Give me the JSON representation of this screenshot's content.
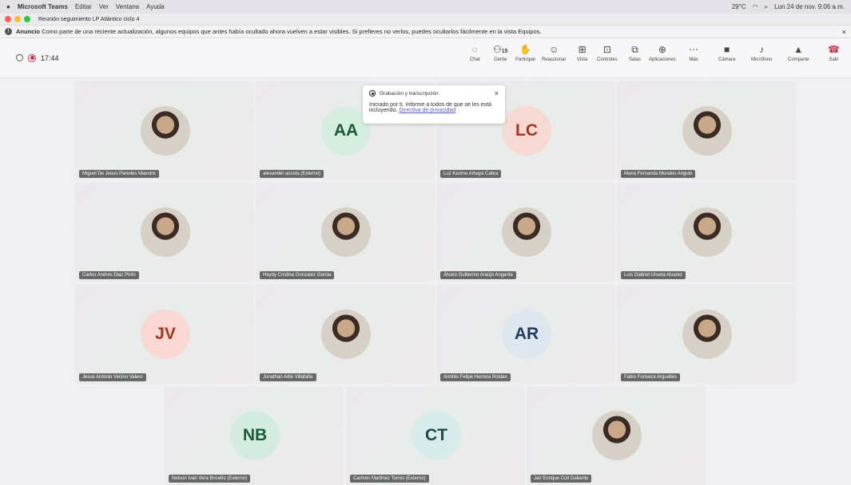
{
  "menubar": {
    "app": "Microsoft Teams",
    "items": [
      "Editar",
      "Ver",
      "Ventana",
      "Ayuda"
    ],
    "temp": "29°C",
    "datetime": "Lun 24 de nov. 9:06 a.m."
  },
  "window": {
    "title": "Reunión seguimiento LP Atlántico ciclo 4"
  },
  "announcement": {
    "label": "Anuncio",
    "text": "Como parte de una reciente actualización, algunos equipos que antes había ocultado ahora vuelven a estar visibles. Si prefieres no verlos, puedes ocultarlos fácilmente en la vista Equipos."
  },
  "meeting": {
    "elapsed": "17:44"
  },
  "toolbar": {
    "chat": "Chat",
    "people": "Gente",
    "people_count": "15",
    "raise": "Participar",
    "react": "Reaccionar",
    "view": "Vista",
    "controls": "Controles",
    "rooms": "Salas",
    "apps": "Aplicaciones",
    "more": "Más",
    "camera": "Cámara",
    "mic": "Micrófono",
    "share": "Comparte",
    "leave": "Salir"
  },
  "popup": {
    "title": "Grabación y transcripción",
    "body": "Iniciado por ti. Informe a todos de que se les está incluyendo.",
    "link": "Directiva de privacidad"
  },
  "participants": [
    {
      "name": "Miguel De Jesus Paredes Maestre",
      "initials": "",
      "photo": true,
      "color": "#cde3d3"
    },
    {
      "name": "alexander acosta (Externo)",
      "initials": "AA",
      "photo": false,
      "color": "#d6eedf",
      "text": "#1a5c3a"
    },
    {
      "name": "Luz Karime Amaya Cabra",
      "initials": "LC",
      "photo": false,
      "color": "#f7d9d3",
      "text": "#a3361e"
    },
    {
      "name": "Maria Fernanda Morales Angulo",
      "initials": "",
      "photo": true
    },
    {
      "name": "Carlos Andres Diaz Pinto",
      "initials": "",
      "photo": true
    },
    {
      "name": "Heydy Cristina Gonzalez Garcia",
      "initials": "",
      "photo": true
    },
    {
      "name": "Álvaro Guillermo Araújo Angarita",
      "initials": "",
      "photo": true
    },
    {
      "name": "Luis Gabriel Urueta Alvarez",
      "initials": "",
      "photo": true
    },
    {
      "name": "Jesus Antonio Vecino Valero",
      "initials": "JV",
      "photo": false,
      "color": "#f9d8d3",
      "text": "#a3361e"
    },
    {
      "name": "Jonathan Adie Villafañe",
      "initials": "",
      "photo": true
    },
    {
      "name": "Andrés Felipe Herrera Roldan",
      "initials": "AR",
      "photo": false,
      "color": "#dfe7ee",
      "text": "#1e3a5c"
    },
    {
      "name": "Fabio Fonseca Arguelles",
      "initials": "",
      "photo": true
    },
    {
      "name": "Nelson Ivan Vera Briceño (Externo)",
      "initials": "NB",
      "photo": false,
      "color": "#d4ece0",
      "text": "#1a5c3a"
    },
    {
      "name": "Carmen Martinez Torres (Externo)",
      "initials": "CT",
      "photo": false,
      "color": "#d8ecec",
      "text": "#1e4a4a"
    },
    {
      "name": "Jair Enrique Coll Gallardo",
      "initials": "",
      "photo": true
    }
  ]
}
